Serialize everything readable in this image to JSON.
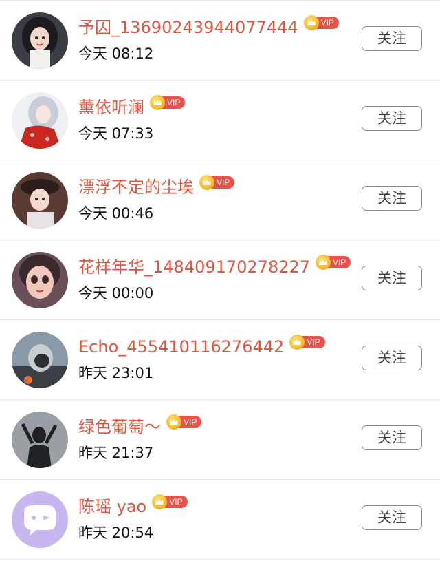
{
  "follow_label": "关注",
  "vip_label": "VIP",
  "users": [
    {
      "name": "予囚_13690243944077444",
      "time": "今天 08:12",
      "avatar": "girl-dark-hair"
    },
    {
      "name": "薰依听澜",
      "time": "今天 07:33",
      "avatar": "girl-red-dress"
    },
    {
      "name": "漂浮不定的尘埃",
      "time": "今天 00:46",
      "avatar": "girl-hat"
    },
    {
      "name": "花样年华_14840917027822​7",
      "time": "今天 00:00",
      "avatar": "doll-face"
    },
    {
      "name": "Echo_455410116276442",
      "time": "昨天 23:01",
      "avatar": "helmet-person"
    },
    {
      "name": "绿色葡萄～",
      "time": "昨天 21:37",
      "avatar": "silhouette"
    },
    {
      "name": "陈瑶 yao",
      "time": "昨天 20:54",
      "avatar": "chat-bubble"
    }
  ]
}
